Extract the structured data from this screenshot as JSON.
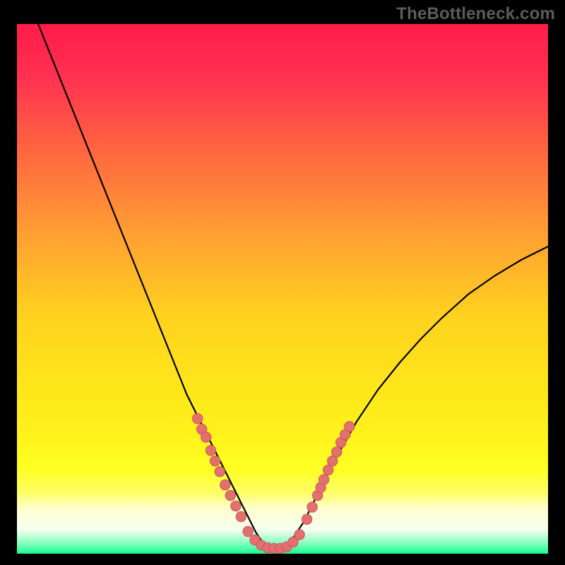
{
  "watermark": "TheBottleneck.com",
  "colors": {
    "frame": "#000000",
    "curve": "#000000",
    "dot_fill": "#e36f6f",
    "dot_stroke": "#c85a5a"
  },
  "gradient_stops": [
    {
      "offset": 0.0,
      "color": "#ff1c4a"
    },
    {
      "offset": 0.1,
      "color": "#ff3150"
    },
    {
      "offset": 0.25,
      "color": "#ff6a3f"
    },
    {
      "offset": 0.4,
      "color": "#ffa032"
    },
    {
      "offset": 0.55,
      "color": "#ffd21f"
    },
    {
      "offset": 0.7,
      "color": "#ffe81a"
    },
    {
      "offset": 0.78,
      "color": "#fff31c"
    },
    {
      "offset": 0.84,
      "color": "#ffff22"
    },
    {
      "offset": 0.885,
      "color": "#ffff66"
    },
    {
      "offset": 0.915,
      "color": "#ffffd0"
    },
    {
      "offset": 0.955,
      "color": "#f5ffef"
    },
    {
      "offset": 0.975,
      "color": "#9fffc8"
    },
    {
      "offset": 0.993,
      "color": "#3effa2"
    },
    {
      "offset": 1.0,
      "color": "#19f58e"
    }
  ],
  "chart_data": {
    "type": "line",
    "title": "",
    "xlabel": "",
    "ylabel": "",
    "xlim": [
      0,
      100
    ],
    "ylim": [
      0,
      100
    ],
    "series": [
      {
        "name": "bottleneck-curve",
        "x": [
          4,
          6,
          8,
          10,
          12,
          14,
          16,
          18,
          20,
          22,
          24,
          26,
          28,
          30,
          32,
          34,
          36,
          38,
          40,
          42,
          44,
          45,
          46,
          47,
          48,
          49,
          50,
          52,
          54,
          56,
          58,
          60,
          64,
          68,
          72,
          76,
          80,
          85,
          90,
          95,
          100
        ],
        "y": [
          100,
          95,
          90,
          85,
          80,
          75,
          70,
          65,
          60,
          55,
          50,
          45,
          40,
          35,
          30,
          26,
          22,
          18,
          14,
          10,
          6,
          4,
          2.5,
          1.5,
          1,
          1,
          1.2,
          3,
          6,
          10,
          14,
          18,
          25,
          31,
          36,
          40.5,
          44.5,
          49,
          52.5,
          55.5,
          58
        ]
      }
    ],
    "dots_left": [
      {
        "x": 34.0,
        "y": 25.5
      },
      {
        "x": 34.8,
        "y": 23.5
      },
      {
        "x": 35.6,
        "y": 22.0
      },
      {
        "x": 36.5,
        "y": 19.5
      },
      {
        "x": 37.3,
        "y": 17.5
      },
      {
        "x": 38.2,
        "y": 15.5
      },
      {
        "x": 39.2,
        "y": 13.0
      },
      {
        "x": 40.2,
        "y": 11.0
      },
      {
        "x": 41.2,
        "y": 9.0
      },
      {
        "x": 42.2,
        "y": 7.0
      }
    ],
    "dots_bottom": [
      {
        "x": 43.5,
        "y": 4.2
      },
      {
        "x": 44.8,
        "y": 2.6
      },
      {
        "x": 46.0,
        "y": 1.6
      },
      {
        "x": 47.2,
        "y": 1.1
      },
      {
        "x": 48.4,
        "y": 1.0
      },
      {
        "x": 49.6,
        "y": 1.0
      },
      {
        "x": 50.8,
        "y": 1.3
      },
      {
        "x": 52.0,
        "y": 2.2
      },
      {
        "x": 53.2,
        "y": 3.6
      }
    ],
    "dots_right": [
      {
        "x": 54.6,
        "y": 6.5
      },
      {
        "x": 55.6,
        "y": 8.8
      },
      {
        "x": 56.6,
        "y": 11.0
      },
      {
        "x": 57.2,
        "y": 12.5
      },
      {
        "x": 57.8,
        "y": 14.0
      },
      {
        "x": 58.6,
        "y": 15.8
      },
      {
        "x": 59.4,
        "y": 17.5
      },
      {
        "x": 60.2,
        "y": 19.2
      },
      {
        "x": 61.0,
        "y": 21.0
      },
      {
        "x": 61.8,
        "y": 22.5
      },
      {
        "x": 62.6,
        "y": 24.0
      }
    ]
  }
}
